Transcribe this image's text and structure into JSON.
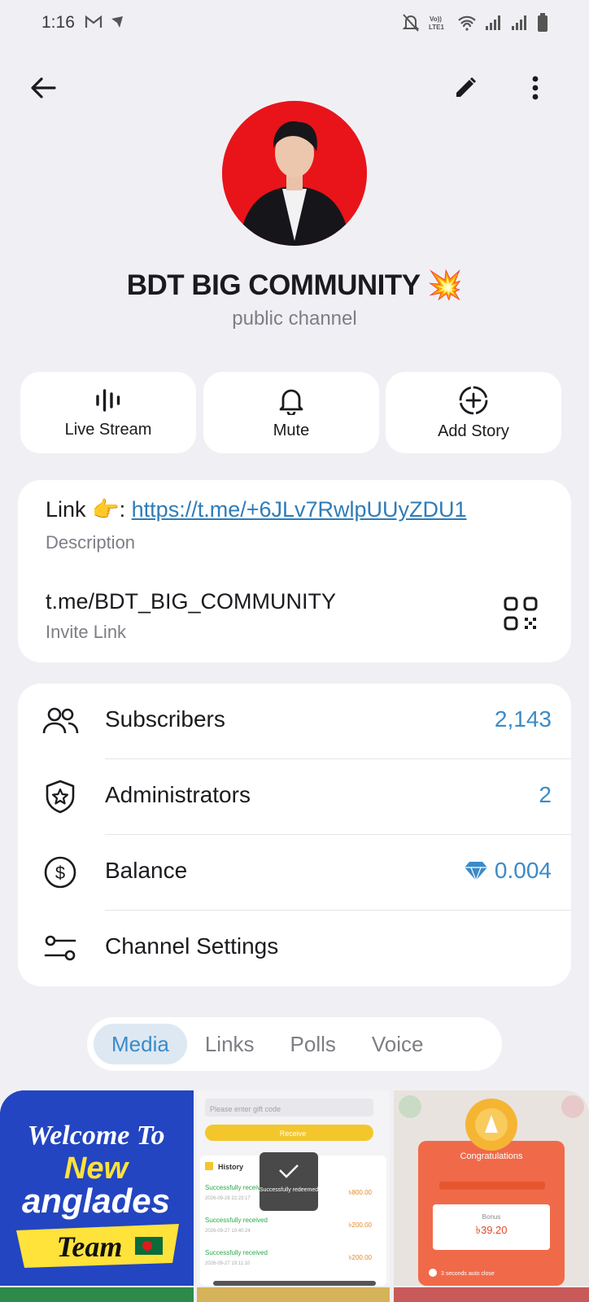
{
  "status_bar": {
    "time": "1:16",
    "left_icons": [
      "gmail-icon",
      "location-arrow-icon"
    ],
    "right_icons": [
      "bell-off-icon",
      "volte-icon",
      "wifi-icon",
      "signal-icon",
      "signal-icon",
      "battery-icon"
    ],
    "volte_text": "Vo)) LTE1"
  },
  "top_bar": {
    "back_icon": "arrow-left-icon",
    "edit_icon": "pencil-icon",
    "menu_icon": "more-vertical-icon"
  },
  "channel": {
    "title": "BDT BIG COMMUNITY 💥",
    "subtitle": "public channel"
  },
  "actions": [
    {
      "label": "Live Stream",
      "icon": "live-stream-icon"
    },
    {
      "label": "Mute",
      "icon": "bell-icon"
    },
    {
      "label": "Add Story",
      "icon": "add-story-icon"
    }
  ],
  "info": {
    "link_prefix": "Link 👉: ",
    "link_url": "https://t.me/+6JLv7RwlpUUyZDU1",
    "description_label": "Description",
    "invite_link": "t.me/BDT_BIG_COMMUNITY",
    "invite_label": "Invite Link"
  },
  "stats": [
    {
      "label": "Subscribers",
      "value": "2,143",
      "icon": "users-icon"
    },
    {
      "label": "Administrators",
      "value": "2",
      "icon": "shield-star-icon"
    },
    {
      "label": "Balance",
      "value": "0.004",
      "icon": "dollar-circle-icon",
      "value_icon": "diamond-icon"
    },
    {
      "label": "Channel Settings",
      "value": "",
      "icon": "sliders-icon"
    }
  ],
  "tabs": [
    {
      "label": "Media",
      "active": true
    },
    {
      "label": "Links",
      "active": false
    },
    {
      "label": "Polls",
      "active": false
    },
    {
      "label": "Voice",
      "active": false
    }
  ],
  "media": {
    "item1": {
      "line1": "Welcome To",
      "line2": "New",
      "line3": "anglades",
      "line4": "Team"
    },
    "item2": {
      "placeholder": "Please enter gift code",
      "button": "Receive",
      "history_title": "History",
      "toast": "Successfully redeemed",
      "rows": [
        {
          "label": "Successfully received",
          "date": "2026-09-28 22:23:17",
          "amount": "৳800.00"
        },
        {
          "label": "Successfully received",
          "date": "2026-09-27 10:40:24",
          "amount": "৳200.00"
        },
        {
          "label": "Successfully received",
          "date": "2026-09-27 19:11:10",
          "amount": "৳200.00"
        }
      ]
    },
    "item3": {
      "title": "Congratulations",
      "bonus_label": "Bonus",
      "bonus_value": "৳39.20",
      "footer": "3 seconds auto close"
    }
  },
  "colors": {
    "accent": "#3a8bc9",
    "background": "#f0f0f4",
    "card": "#ffffff"
  }
}
